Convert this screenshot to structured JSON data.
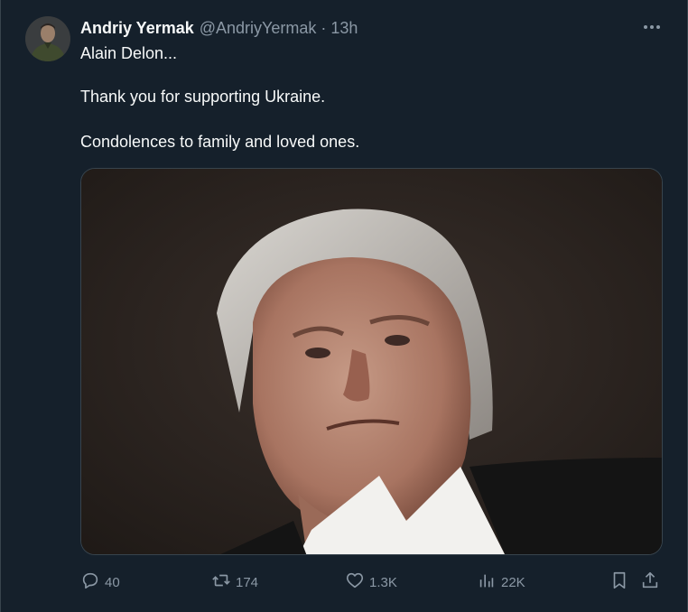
{
  "author": {
    "name": "Andriy Yermak",
    "handle": "@AndriyYermak",
    "separator": "·",
    "time": "13h"
  },
  "tweet": {
    "lines": [
      "Alain Delon...",
      "Thank you for supporting Ukraine.",
      "Condolences to family and loved ones."
    ]
  },
  "media": {
    "description": "photo"
  },
  "actions": {
    "replies": "40",
    "retweets": "174",
    "likes": "1.3K",
    "views": "22K"
  },
  "icons": {
    "more": "more-icon",
    "reply": "reply-icon",
    "retweet": "retweet-icon",
    "like": "heart-icon",
    "views": "views-icon",
    "bookmark": "bookmark-icon",
    "share": "share-icon"
  },
  "colors": {
    "background": "#15202b",
    "text": "#f7f9f9",
    "secondary": "#8b98a5",
    "border": "#38444d"
  }
}
